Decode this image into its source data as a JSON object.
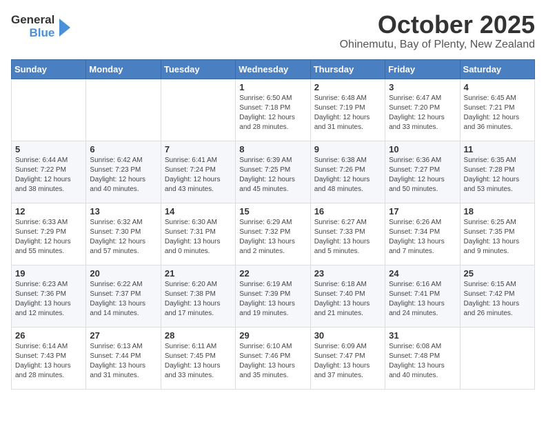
{
  "header": {
    "logo_general": "General",
    "logo_blue": "Blue",
    "month_title": "October 2025",
    "location": "Ohinemutu, Bay of Plenty, New Zealand"
  },
  "weekdays": [
    "Sunday",
    "Monday",
    "Tuesday",
    "Wednesday",
    "Thursday",
    "Friday",
    "Saturday"
  ],
  "weeks": [
    [
      {
        "day": "",
        "sunrise": "",
        "sunset": "",
        "daylight": ""
      },
      {
        "day": "",
        "sunrise": "",
        "sunset": "",
        "daylight": ""
      },
      {
        "day": "",
        "sunrise": "",
        "sunset": "",
        "daylight": ""
      },
      {
        "day": "1",
        "sunrise": "Sunrise: 6:50 AM",
        "sunset": "Sunset: 7:18 PM",
        "daylight": "Daylight: 12 hours and 28 minutes."
      },
      {
        "day": "2",
        "sunrise": "Sunrise: 6:48 AM",
        "sunset": "Sunset: 7:19 PM",
        "daylight": "Daylight: 12 hours and 31 minutes."
      },
      {
        "day": "3",
        "sunrise": "Sunrise: 6:47 AM",
        "sunset": "Sunset: 7:20 PM",
        "daylight": "Daylight: 12 hours and 33 minutes."
      },
      {
        "day": "4",
        "sunrise": "Sunrise: 6:45 AM",
        "sunset": "Sunset: 7:21 PM",
        "daylight": "Daylight: 12 hours and 36 minutes."
      }
    ],
    [
      {
        "day": "5",
        "sunrise": "Sunrise: 6:44 AM",
        "sunset": "Sunset: 7:22 PM",
        "daylight": "Daylight: 12 hours and 38 minutes."
      },
      {
        "day": "6",
        "sunrise": "Sunrise: 6:42 AM",
        "sunset": "Sunset: 7:23 PM",
        "daylight": "Daylight: 12 hours and 40 minutes."
      },
      {
        "day": "7",
        "sunrise": "Sunrise: 6:41 AM",
        "sunset": "Sunset: 7:24 PM",
        "daylight": "Daylight: 12 hours and 43 minutes."
      },
      {
        "day": "8",
        "sunrise": "Sunrise: 6:39 AM",
        "sunset": "Sunset: 7:25 PM",
        "daylight": "Daylight: 12 hours and 45 minutes."
      },
      {
        "day": "9",
        "sunrise": "Sunrise: 6:38 AM",
        "sunset": "Sunset: 7:26 PM",
        "daylight": "Daylight: 12 hours and 48 minutes."
      },
      {
        "day": "10",
        "sunrise": "Sunrise: 6:36 AM",
        "sunset": "Sunset: 7:27 PM",
        "daylight": "Daylight: 12 hours and 50 minutes."
      },
      {
        "day": "11",
        "sunrise": "Sunrise: 6:35 AM",
        "sunset": "Sunset: 7:28 PM",
        "daylight": "Daylight: 12 hours and 53 minutes."
      }
    ],
    [
      {
        "day": "12",
        "sunrise": "Sunrise: 6:33 AM",
        "sunset": "Sunset: 7:29 PM",
        "daylight": "Daylight: 12 hours and 55 minutes."
      },
      {
        "day": "13",
        "sunrise": "Sunrise: 6:32 AM",
        "sunset": "Sunset: 7:30 PM",
        "daylight": "Daylight: 12 hours and 57 minutes."
      },
      {
        "day": "14",
        "sunrise": "Sunrise: 6:30 AM",
        "sunset": "Sunset: 7:31 PM",
        "daylight": "Daylight: 13 hours and 0 minutes."
      },
      {
        "day": "15",
        "sunrise": "Sunrise: 6:29 AM",
        "sunset": "Sunset: 7:32 PM",
        "daylight": "Daylight: 13 hours and 2 minutes."
      },
      {
        "day": "16",
        "sunrise": "Sunrise: 6:27 AM",
        "sunset": "Sunset: 7:33 PM",
        "daylight": "Daylight: 13 hours and 5 minutes."
      },
      {
        "day": "17",
        "sunrise": "Sunrise: 6:26 AM",
        "sunset": "Sunset: 7:34 PM",
        "daylight": "Daylight: 13 hours and 7 minutes."
      },
      {
        "day": "18",
        "sunrise": "Sunrise: 6:25 AM",
        "sunset": "Sunset: 7:35 PM",
        "daylight": "Daylight: 13 hours and 9 minutes."
      }
    ],
    [
      {
        "day": "19",
        "sunrise": "Sunrise: 6:23 AM",
        "sunset": "Sunset: 7:36 PM",
        "daylight": "Daylight: 13 hours and 12 minutes."
      },
      {
        "day": "20",
        "sunrise": "Sunrise: 6:22 AM",
        "sunset": "Sunset: 7:37 PM",
        "daylight": "Daylight: 13 hours and 14 minutes."
      },
      {
        "day": "21",
        "sunrise": "Sunrise: 6:20 AM",
        "sunset": "Sunset: 7:38 PM",
        "daylight": "Daylight: 13 hours and 17 minutes."
      },
      {
        "day": "22",
        "sunrise": "Sunrise: 6:19 AM",
        "sunset": "Sunset: 7:39 PM",
        "daylight": "Daylight: 13 hours and 19 minutes."
      },
      {
        "day": "23",
        "sunrise": "Sunrise: 6:18 AM",
        "sunset": "Sunset: 7:40 PM",
        "daylight": "Daylight: 13 hours and 21 minutes."
      },
      {
        "day": "24",
        "sunrise": "Sunrise: 6:16 AM",
        "sunset": "Sunset: 7:41 PM",
        "daylight": "Daylight: 13 hours and 24 minutes."
      },
      {
        "day": "25",
        "sunrise": "Sunrise: 6:15 AM",
        "sunset": "Sunset: 7:42 PM",
        "daylight": "Daylight: 13 hours and 26 minutes."
      }
    ],
    [
      {
        "day": "26",
        "sunrise": "Sunrise: 6:14 AM",
        "sunset": "Sunset: 7:43 PM",
        "daylight": "Daylight: 13 hours and 28 minutes."
      },
      {
        "day": "27",
        "sunrise": "Sunrise: 6:13 AM",
        "sunset": "Sunset: 7:44 PM",
        "daylight": "Daylight: 13 hours and 31 minutes."
      },
      {
        "day": "28",
        "sunrise": "Sunrise: 6:11 AM",
        "sunset": "Sunset: 7:45 PM",
        "daylight": "Daylight: 13 hours and 33 minutes."
      },
      {
        "day": "29",
        "sunrise": "Sunrise: 6:10 AM",
        "sunset": "Sunset: 7:46 PM",
        "daylight": "Daylight: 13 hours and 35 minutes."
      },
      {
        "day": "30",
        "sunrise": "Sunrise: 6:09 AM",
        "sunset": "Sunset: 7:47 PM",
        "daylight": "Daylight: 13 hours and 37 minutes."
      },
      {
        "day": "31",
        "sunrise": "Sunrise: 6:08 AM",
        "sunset": "Sunset: 7:48 PM",
        "daylight": "Daylight: 13 hours and 40 minutes."
      },
      {
        "day": "",
        "sunrise": "",
        "sunset": "",
        "daylight": ""
      }
    ]
  ]
}
